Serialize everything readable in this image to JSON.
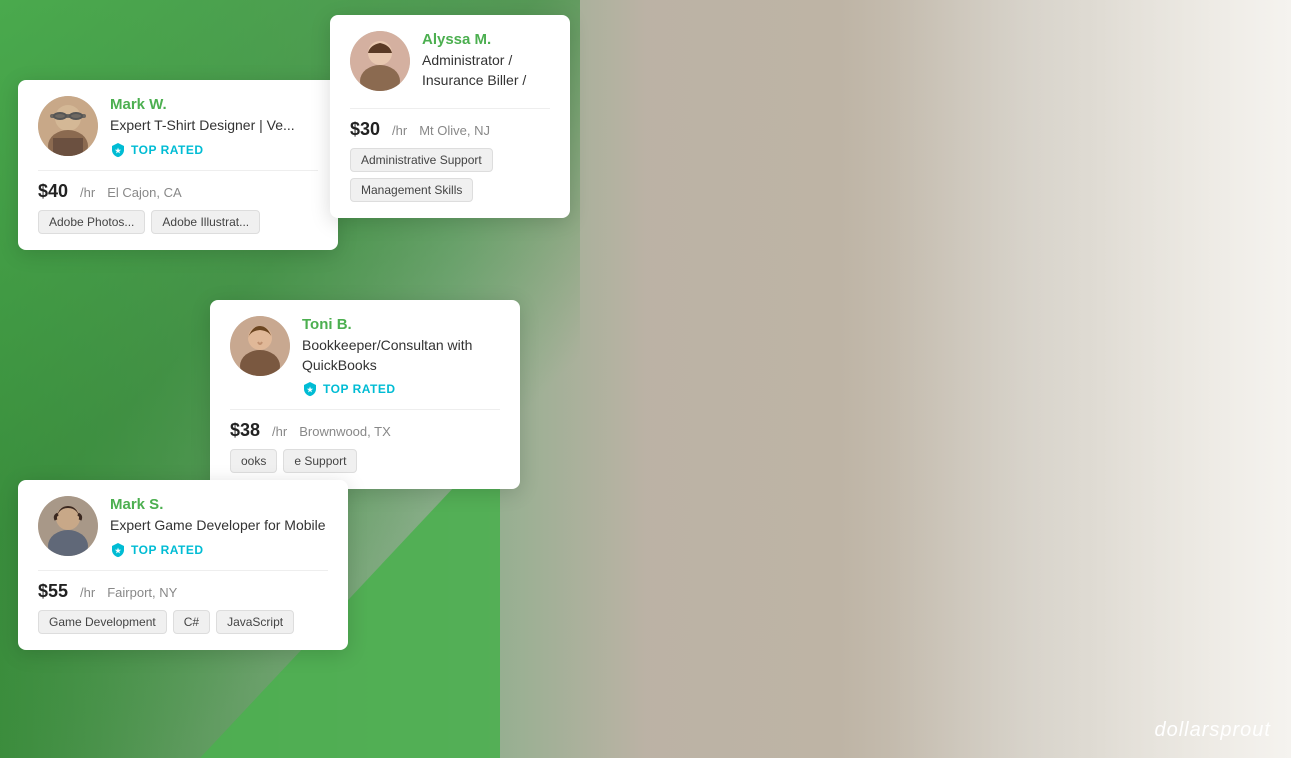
{
  "background": {
    "alt": "Man working at computer in office"
  },
  "logo": {
    "text": "dollarsprout",
    "dollar": "dollar",
    "sprout": "sprout"
  },
  "cards": {
    "mark_w": {
      "name": "Mark W.",
      "title": "Expert T-Shirt Designer | Ve...",
      "top_rated": "TOP RATED",
      "rate": "$40",
      "rate_unit": "/hr",
      "location": "El Cajon, CA",
      "skills": [
        "Adobe Photos...",
        "Adobe Illustrat..."
      ]
    },
    "alyssa": {
      "name": "Alyssa M.",
      "title": "Administrator / Insurance Biller /",
      "rate": "$30",
      "rate_unit": "/hr",
      "location": "Mt Olive, NJ",
      "skills": [
        "Administrative Support",
        "Management Skills"
      ]
    },
    "toni": {
      "name": "Toni B.",
      "title": "Bookkeeper/Consultan with QuickBooks",
      "top_rated": "TOP RATED",
      "rate": "$38",
      "rate_unit": "/hr",
      "location": "Brownwood, TX",
      "skills": [
        "ooks",
        "e Support"
      ]
    },
    "mark_s": {
      "name": "Mark S.",
      "title": "Expert Game Developer for Mobile",
      "top_rated": "TOP RATED",
      "rate": "$55",
      "rate_unit": "/hr",
      "location": "Fairport, NY",
      "skills": [
        "Game Development",
        "C#",
        "JavaScript"
      ]
    }
  }
}
